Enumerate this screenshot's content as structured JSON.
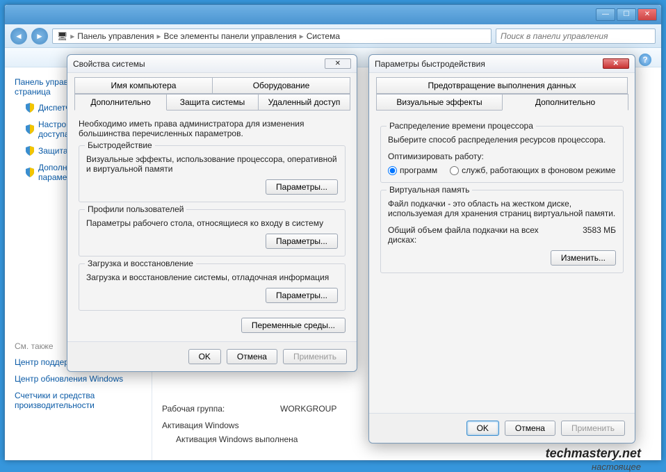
{
  "breadcrumb": {
    "item1": "Панель управления",
    "item2": "Все элементы панели управления",
    "item3": "Система"
  },
  "search": {
    "placeholder": "Поиск в панели управления"
  },
  "sidebar": {
    "header": "Панель управления - домашняя страница",
    "items": [
      "Диспетчер устройств",
      "Настройка удаленного доступа",
      "Защита системы",
      "Дополнительные параметры системы"
    ],
    "see_also": "См. также",
    "links2": [
      "Центр поддержки",
      "Центр обновления Windows",
      "Счетчики и средства производительности"
    ]
  },
  "content": {
    "workgroup_label": "Рабочая группа:",
    "workgroup_value": "WORKGROUP",
    "activation_hdr": "Активация Windows",
    "activation_line": "Активация Windows выполнена"
  },
  "dlg1": {
    "title": "Свойства системы",
    "tabs_row1": [
      "Имя компьютера",
      "Оборудование"
    ],
    "tabs_row2": [
      "Дополнительно",
      "Защита системы",
      "Удаленный доступ"
    ],
    "intro": "Необходимо иметь права администратора для изменения большинства перечисленных параметров.",
    "g1": {
      "title": "Быстродействие",
      "text": "Визуальные эффекты, использование процессора, оперативной и виртуальной памяти",
      "btn": "Параметры..."
    },
    "g2": {
      "title": "Профили пользователей",
      "text": "Параметры рабочего стола, относящиеся ко входу в систему",
      "btn": "Параметры..."
    },
    "g3": {
      "title": "Загрузка и восстановление",
      "text": "Загрузка и восстановление системы, отладочная информация",
      "btn": "Параметры..."
    },
    "envbtn": "Переменные среды...",
    "ok": "OK",
    "cancel": "Отмена",
    "apply": "Применить"
  },
  "dlg2": {
    "title": "Параметры быстродействия",
    "tabs_row1": [
      "Предотвращение выполнения данных"
    ],
    "tabs_row2": [
      "Визуальные эффекты",
      "Дополнительно"
    ],
    "sched": {
      "title": "Распределение времени процессора",
      "text": "Выберите способ распределения ресурсов процессора.",
      "opt_label": "Оптимизировать работу:",
      "opt_programs": "программ",
      "opt_services": "служб, работающих в фоновом режиме"
    },
    "vm": {
      "title": "Виртуальная память",
      "text": "Файл подкачки - это область на жестком диске, используемая для хранения страниц виртуальной памяти.",
      "total_label": "Общий объем файла подкачки на всех дисках:",
      "total_value": "3583 МБ",
      "btn": "Изменить..."
    },
    "ok": "OK",
    "cancel": "Отмена",
    "apply": "Применить"
  },
  "watermark": "techmastery.net",
  "watermark2": "настоящее"
}
